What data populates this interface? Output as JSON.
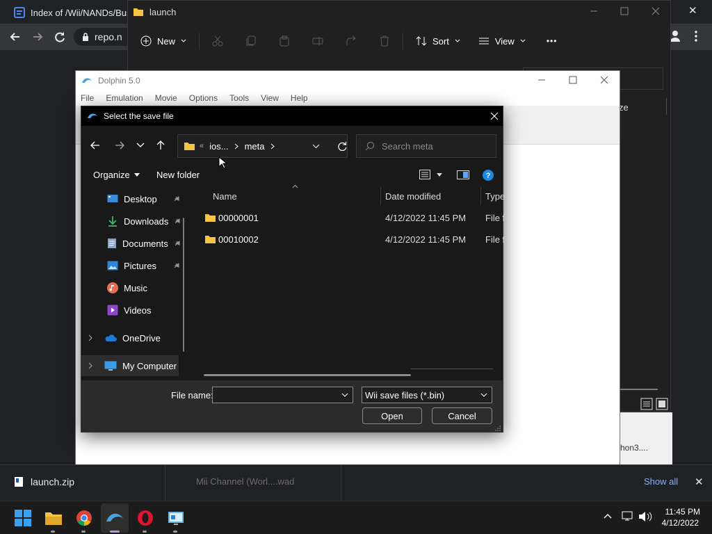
{
  "browser": {
    "tab_title": "Index of /Wii/NANDs/Busl",
    "url": "repo.n",
    "close": "✕"
  },
  "explorer": {
    "title": "launch",
    "new_label": "New",
    "sort_label": "Sort",
    "view_label": "View",
    "more_label": "•••",
    "col_size": "ze",
    "frag_text": "hon3...."
  },
  "dolphin": {
    "title": "Dolphin 5.0",
    "menu": [
      "File",
      "Emulation",
      "Movie",
      "Options",
      "Tools",
      "View",
      "Help"
    ]
  },
  "dialog": {
    "title": "Select the save file",
    "breadcrumb": [
      "ios...",
      "meta"
    ],
    "breadcrumb_prefix": "«",
    "search_placeholder": "Search meta",
    "organize_label": "Organize",
    "new_folder_label": "New folder",
    "sidebar": [
      {
        "label": "Desktop",
        "icon": "desktop-icon",
        "pinned": true
      },
      {
        "label": "Downloads",
        "icon": "download-icon",
        "pinned": true
      },
      {
        "label": "Documents",
        "icon": "document-icon",
        "pinned": true
      },
      {
        "label": "Pictures",
        "icon": "pictures-icon",
        "pinned": true
      },
      {
        "label": "Music",
        "icon": "music-icon",
        "pinned": false
      },
      {
        "label": "Videos",
        "icon": "videos-icon",
        "pinned": false
      },
      {
        "label": "OneDrive",
        "icon": "cloud-icon",
        "pinned": false
      },
      {
        "label": "My Computer",
        "icon": "computer-icon",
        "pinned": false
      }
    ],
    "columns": [
      "Name",
      "Date modified",
      "Type"
    ],
    "files": [
      {
        "name": "00000001",
        "date": "4/12/2022 11:45 PM",
        "type": "File fo"
      },
      {
        "name": "00010002",
        "date": "4/12/2022 11:45 PM",
        "type": "File fo"
      }
    ],
    "filename_label": "File name:",
    "filename_value": "",
    "filetype_value": "Wii save files (*.bin)",
    "open_label": "Open",
    "cancel_label": "Cancel"
  },
  "downloads_bar": {
    "file": "launch.zip",
    "file2": "Mii Channel (Worl....wad",
    "show_all": "Show all",
    "close": "✕"
  },
  "taskbar": {
    "time": "11:45 PM",
    "date": "4/12/2022"
  },
  "colors": {
    "accent": "#60cdff",
    "folder": "#f6c343"
  }
}
